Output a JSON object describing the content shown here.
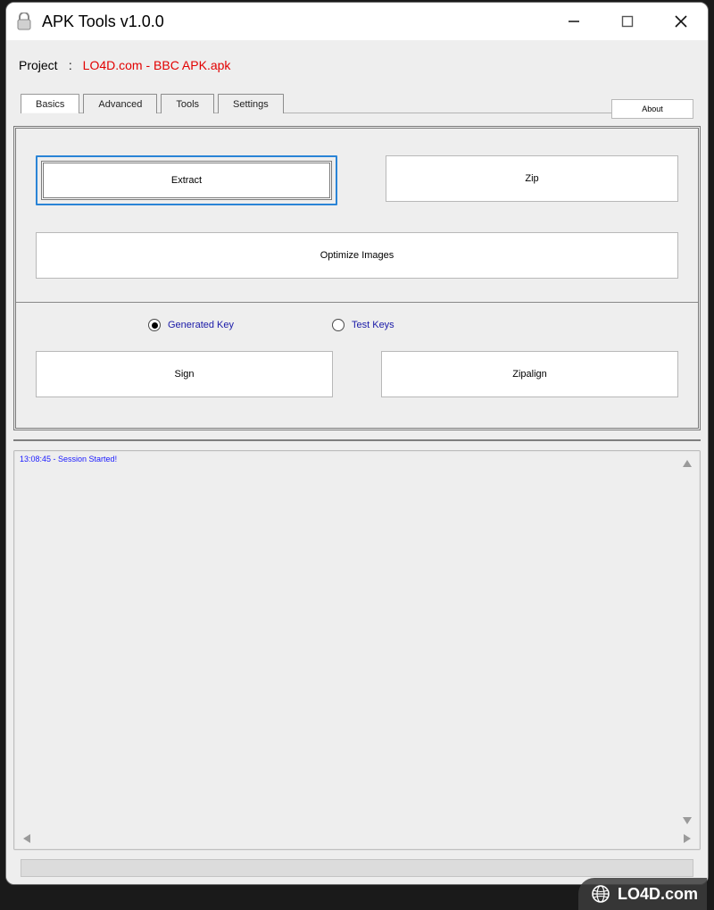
{
  "window": {
    "title": "APK Tools v1.0.0"
  },
  "project": {
    "label": "Project",
    "separator": ":",
    "value": "LO4D.com - BBC APK.apk"
  },
  "tabs": {
    "basics": "Basics",
    "advanced": "Advanced",
    "tools": "Tools",
    "settings": "Settings",
    "about": "About"
  },
  "buttons": {
    "extract": "Extract",
    "zip": "Zip",
    "optimize": "Optimize Images",
    "sign": "Sign",
    "zipalign": "Zipalign"
  },
  "radios": {
    "generated": "Generated Key",
    "test": "Test Keys"
  },
  "log": {
    "entry": "13:08:45 - Session Started!"
  },
  "watermark": {
    "text": "LO4D.com"
  }
}
